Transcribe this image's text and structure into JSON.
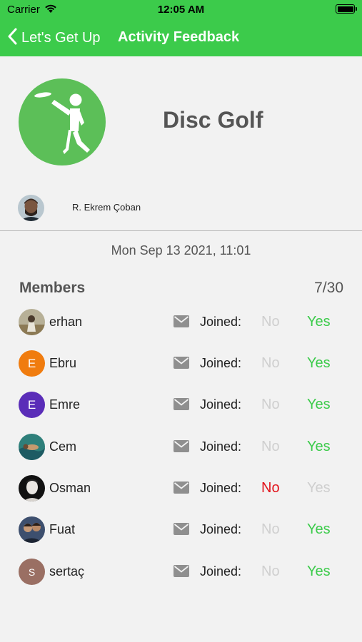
{
  "status_bar": {
    "carrier": "Carrier",
    "time": "12:05 AM"
  },
  "nav": {
    "back_label": "Let's Get Up",
    "title": "Activity Feedback"
  },
  "colors": {
    "brand_green": "#3ccb4b",
    "no_red": "#e2141c",
    "inactive_gray": "#cfcfcf"
  },
  "activity": {
    "title": "Disc Golf",
    "icon": "frisbee-player-icon"
  },
  "organizer": {
    "name": "R. Ekrem Çoban"
  },
  "datetime": "Mon Sep 13 2021, 11:01",
  "members_section": {
    "label": "Members",
    "count": "7/30",
    "joined_label": "Joined:",
    "no_label": "No",
    "yes_label": "Yes"
  },
  "members": [
    {
      "name": "erhan",
      "initial": "",
      "avatar_color": "#8a7a5a",
      "joined": "yes"
    },
    {
      "name": "Ebru",
      "initial": "E",
      "avatar_color": "#f07c0f",
      "joined": "yes"
    },
    {
      "name": "Emre",
      "initial": "E",
      "avatar_color": "#5a2db8",
      "joined": "yes"
    },
    {
      "name": "Cem",
      "initial": "",
      "avatar_color": "#2f7d6a",
      "joined": "yes"
    },
    {
      "name": "Osman",
      "initial": "",
      "avatar_color": "#1a1a1a",
      "joined": "no"
    },
    {
      "name": "Fuat",
      "initial": "",
      "avatar_color": "#3d4f6e",
      "joined": "yes"
    },
    {
      "name": "sertaç",
      "initial": "S",
      "avatar_color": "#9a6f63",
      "joined": "yes"
    }
  ]
}
